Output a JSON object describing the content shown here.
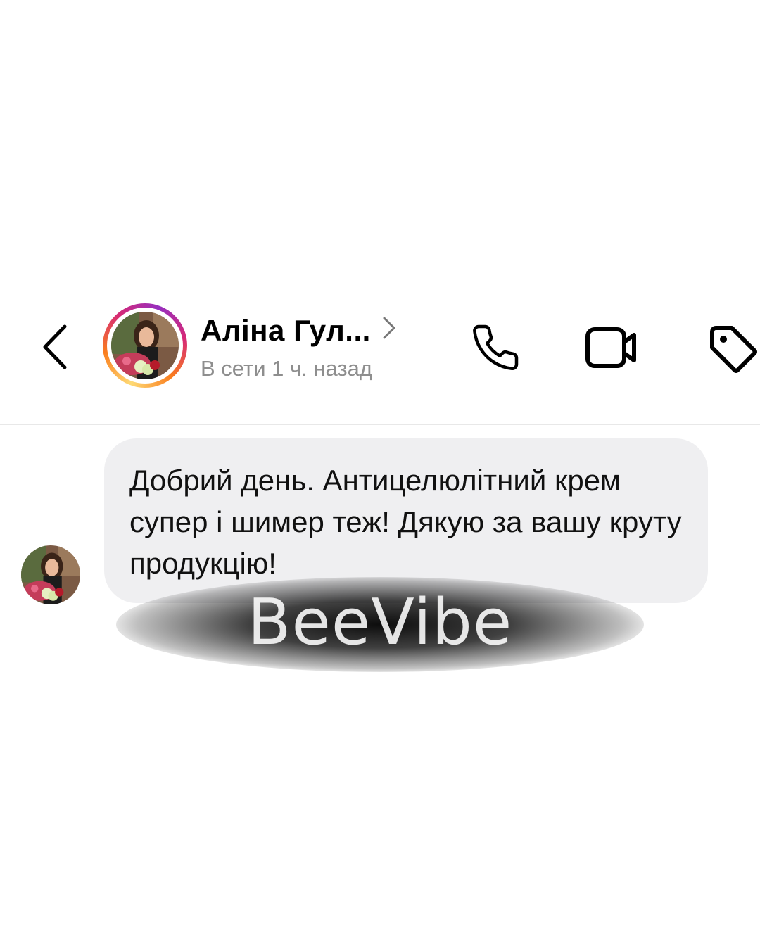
{
  "header": {
    "contact_name": "Аліна Гул...",
    "status": "В сети 1 ч. назад",
    "icons": {
      "back": "chevron-left-icon",
      "profile": "chevron-right-icon",
      "call": "phone-icon",
      "video": "video-camera-icon",
      "tag": "tag-icon"
    },
    "story_ring_colors": [
      "#feda75",
      "#fa7e1e",
      "#d62976",
      "#962fbf"
    ]
  },
  "message": {
    "text": "Добрий день. Антицелюлітний крем супер і шимер теж! Дякую за вашу круту продукцію!",
    "bubble_color": "#efeff1"
  },
  "watermark": {
    "text": "BeeVibe"
  }
}
